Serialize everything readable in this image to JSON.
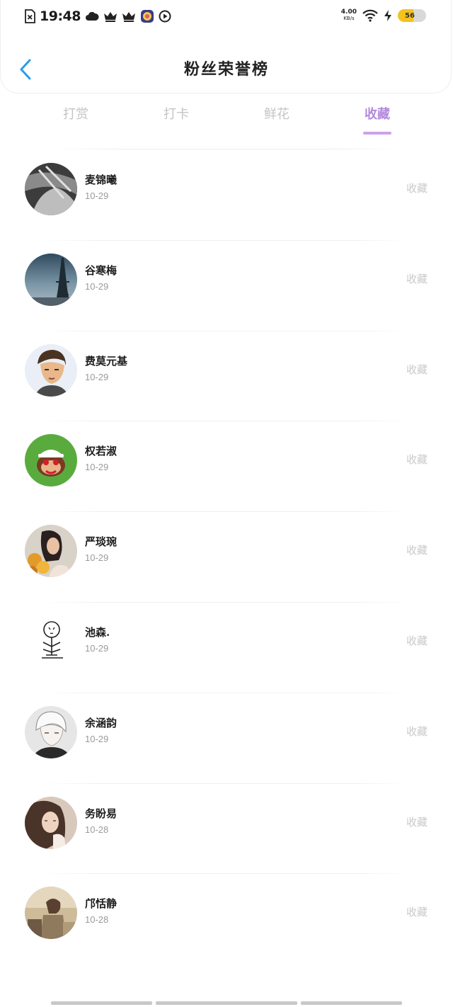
{
  "status_bar": {
    "time": "19:48",
    "net_speed_value": "4.00",
    "net_speed_unit": "KB/s",
    "battery_level": "56",
    "icons": [
      "sim-error-icon",
      "cloud-icon",
      "crown-icon",
      "crown-icon",
      "app-badge-icon",
      "play-icon",
      "wifi-icon",
      "charging-icon"
    ]
  },
  "header": {
    "title": "粉丝荣誉榜",
    "back_icon": "chevron-left-icon"
  },
  "tabs": [
    {
      "label": "打赏",
      "active": false
    },
    {
      "label": "打卡",
      "active": false
    },
    {
      "label": "鲜花",
      "active": false
    },
    {
      "label": "收藏",
      "active": true
    }
  ],
  "list": {
    "items": [
      {
        "name": "麦锦曦",
        "date": "10-29",
        "action": "收藏"
      },
      {
        "name": "谷寒梅",
        "date": "10-29",
        "action": "收藏"
      },
      {
        "name": "费莫元基",
        "date": "10-29",
        "action": "收藏"
      },
      {
        "name": "权若淑",
        "date": "10-29",
        "action": "收藏"
      },
      {
        "name": "严琰琬",
        "date": "10-29",
        "action": "收藏"
      },
      {
        "name": "池森.",
        "date": "10-29",
        "action": "收藏"
      },
      {
        "name": "余涵韵",
        "date": "10-29",
        "action": "收藏"
      },
      {
        "name": "务盼易",
        "date": "10-28",
        "action": "收藏"
      },
      {
        "name": "邝恬静",
        "date": "10-28",
        "action": "收藏"
      }
    ]
  },
  "colors": {
    "accent": "#b389dc",
    "tab_inactive": "#c4c4c4",
    "back_arrow": "#2a9bea",
    "battery": "#f4c21a"
  }
}
